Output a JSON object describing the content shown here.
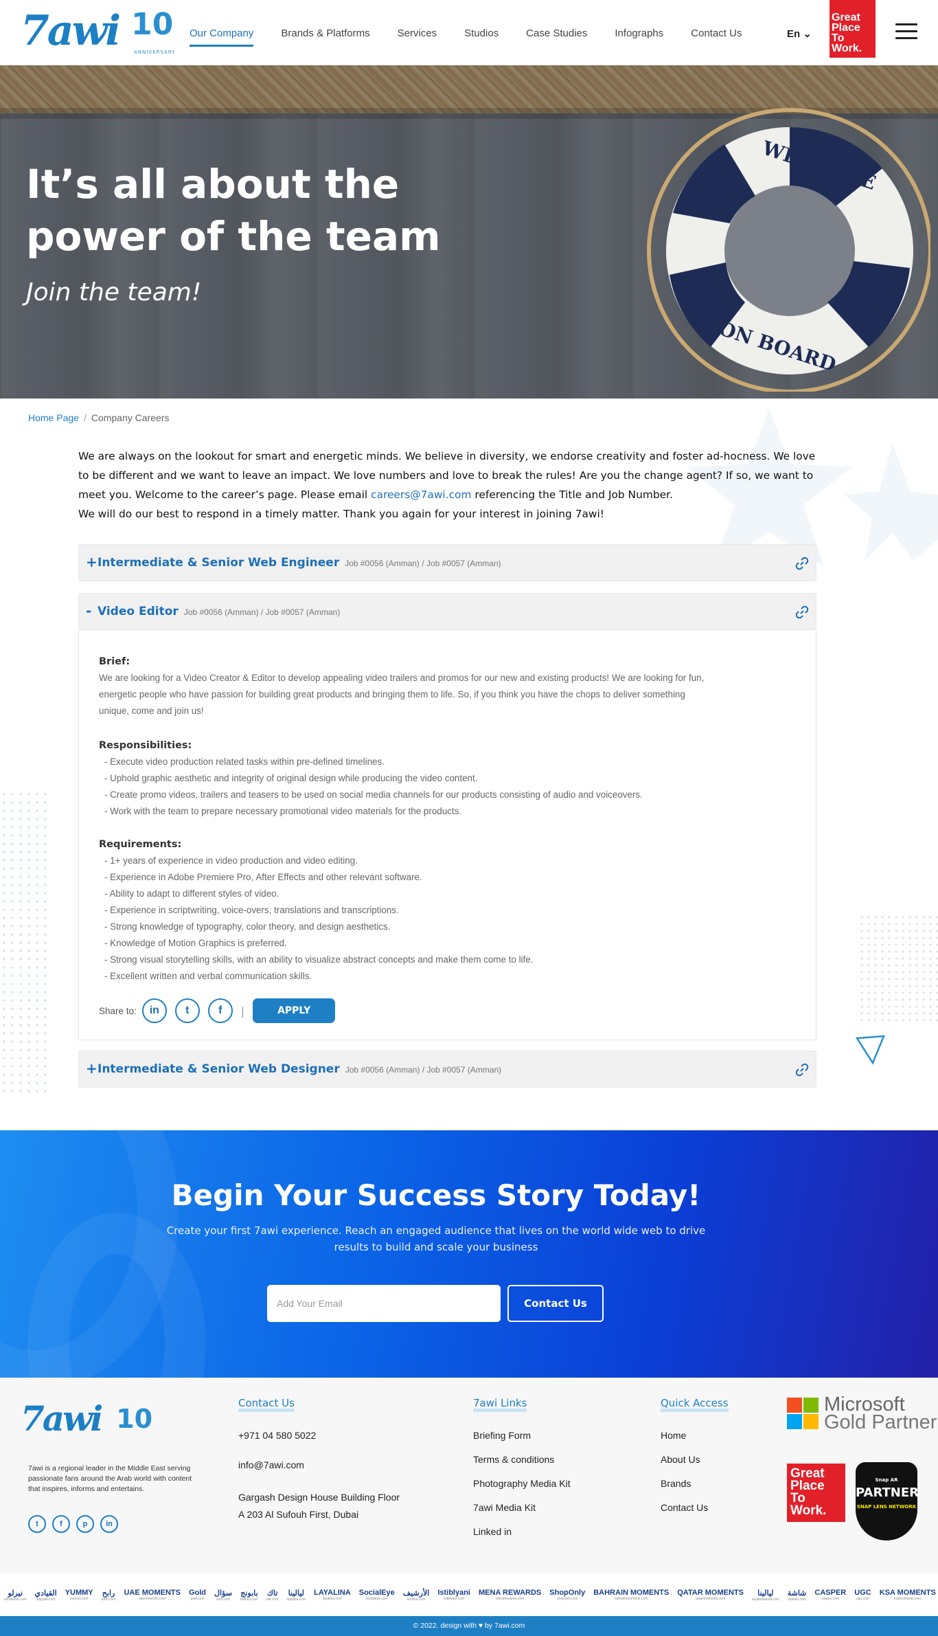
{
  "header": {
    "logo_text": "7awi",
    "anniversary_number": "10",
    "anniversary_label": "ANNIVERSARY",
    "nav": [
      "Our Company",
      "Brands & Platforms",
      "Services",
      "Studios",
      "Case Studies",
      "Infographs",
      "Contact Us"
    ],
    "active_nav": "Our Company",
    "language": "En",
    "gptw_badge": [
      "Great",
      "Place",
      "To",
      "Work."
    ]
  },
  "hero": {
    "title_line1": "It’s all about the",
    "title_line2": "power of the team",
    "subtitle": "Join the team!",
    "buoy_top": "WELCOME",
    "buoy_bottom": "ON BOARD"
  },
  "breadcrumb": {
    "home": "Home Page",
    "separator": "/",
    "current": "Company Careers"
  },
  "intro": {
    "line1": "We are always on the lookout for smart and energetic minds. We believe in diversity, we endorse creativity and foster ad-hocness. We love to be different and we want to leave an impact. We love numbers and love to break the rules! Are you the change agent? If so, we want to meet you. Welcome to the career’s page. Please email ",
    "email": "careers@7awi.com",
    "line1_end": " referencing the Title and Job Number.",
    "line2": "We will do our best to respond in a timely matter. Thank you again for your interest in joining 7awi!"
  },
  "jobs": [
    {
      "toggle": "+",
      "title": "Intermediate & Senior Web Engineer",
      "number": "Job #0056 (Amman) / Job #0057 (Amman)"
    },
    {
      "toggle": "-",
      "title": "Video Editor",
      "number": "Job #0056 (Amman) / Job #0057 (Amman)"
    },
    {
      "toggle": "+",
      "title": "Intermediate & Senior Web Designer",
      "number": "Job #0056 (Amman) / Job #0057 (Amman)"
    }
  ],
  "video_editor": {
    "brief_heading": "Brief:",
    "brief_line1": "We are looking for a Video Creator & Editor to develop appealing video trailers and promos for our new and existing products! We are looking for fun,",
    "brief_line2": "energetic people who have passion for building great products and bringing them to life. So, if you think you have the chops to deliver something",
    "brief_line3": "unique, come and join us!",
    "responsibilities_heading": "Responsibilities:",
    "responsibilities": [
      "- Execute video production related tasks within pre-defined timelines.",
      "- Uphold graphic aesthetic and integrity of original design while producing the video content.",
      "- Create promo videos, trailers and teasers to be used on social media channels for our products consisting of audio and voiceovers.",
      "- Work with the team to prepare necessary promotional video materials for the products."
    ],
    "requirements_heading": "Requirements:",
    "requirements": [
      "- 1+ years of experience in video production and video editing.",
      "- Experience in Adobe Premiere Pro, After Effects and other relevant software.",
      "- Ability to adapt to different styles of video.",
      "- Experience in scriptwriting, voice-overs, translations and transcriptions.",
      "- Strong knowledge of typography, color theory, and design aesthetics.",
      "- Knowledge of Motion Graphics is preferred.",
      "- Strong visual storytelling skills, with an ability to visualize abstract concepts and make them come to life.",
      "- Excellent written and verbal communication skills."
    ],
    "share_label": "Share to:",
    "share_linkedin": "in",
    "share_twitter": "t",
    "share_facebook": "f",
    "share_divider": "|",
    "apply_label": "APPLY"
  },
  "cta": {
    "title": "Begin Your Success Story Today!",
    "text_line1": "Create your first 7awi experience. Reach an engaged audience that lives on the world wide web to drive",
    "text_line2": "results to build and scale your business",
    "email_placeholder": "Add Your Email",
    "button": "Contact Us"
  },
  "footer": {
    "about": "7awi is a regional leader in the Middle East serving passionate fans around the Arab world with content that inspires, informs and entertains.",
    "social": [
      "t",
      "f",
      "p",
      "in"
    ],
    "contact_heading": "Contact Us",
    "phone": "+971 04 580 5022",
    "email": "info@7awi.com",
    "address_line1": "Gargash Design House Building Floor",
    "address_line2": "A 203 Al Sufouh First, Dubai",
    "links_heading": "7awi Links",
    "links": [
      "Briefing Form",
      "Terms & conditions",
      "Photography Media Kit",
      "7awi Media Kit",
      "Linked in"
    ],
    "quick_heading": "Quick Access",
    "quick": [
      "Home",
      "About Us",
      "Brands",
      "Contact Us"
    ],
    "microsoft_line1": "Microsoft",
    "microsoft_line2": "Gold Partner",
    "gptw": [
      "Great",
      "Place",
      "To",
      "Work."
    ],
    "snap_top": "Snap AR",
    "snap_main": "PARTNER",
    "snap_sub": "SNAP LENS NETWORK"
  },
  "brands": [
    {
      "name": "نيرلو",
      "site": "zerdlazde.com"
    },
    {
      "name": "القيادي",
      "site": "alqiyadi.com"
    },
    {
      "name": "YUMMY",
      "site": "yummy.com"
    },
    {
      "name": "رابح",
      "site": "rbbh.com"
    },
    {
      "name": "UAE MOMENTS",
      "site": "uaemoments.com"
    },
    {
      "name": "Gold",
      "site": "gold.com"
    },
    {
      "name": "سؤال",
      "site": "sool.com"
    },
    {
      "name": "بابونج",
      "site": "babunj.com"
    },
    {
      "name": "تاك",
      "site": "tak.com"
    },
    {
      "name": "ليالينا",
      "site": "layalina.com"
    },
    {
      "name": "LAYALINA",
      "site": "layalina.com"
    },
    {
      "name": "SocialEye",
      "site": "socialeye.com"
    },
    {
      "name": "الأرشيف",
      "site": "archive.com"
    },
    {
      "name": "Istiblyani",
      "site": "istiblyani.com"
    },
    {
      "name": "MENA REWARDS",
      "site": "menarewards.com"
    },
    {
      "name": "ShopOnly",
      "site": "shoponly.com"
    },
    {
      "name": "BAHRAIN MOMENTS",
      "site": "bahrainmoments.com"
    },
    {
      "name": "QATAR MOMENTS",
      "site": "qatarmoments.com"
    },
    {
      "name": "ليالينا",
      "site": "layalinasaudi.com"
    },
    {
      "name": "شاشة",
      "site": "shasha.com"
    },
    {
      "name": "CASPER",
      "site": "casper.com"
    },
    {
      "name": "UGC",
      "site": "ugc.com"
    },
    {
      "name": "KSA MOMENTS",
      "site": "ksamoments.com"
    }
  ],
  "copyright": "© 2022. design with ♥ by 7awi.com",
  "colors": {
    "brand_blue": "#1e7fc4",
    "gptw_red": "#e2202a"
  }
}
